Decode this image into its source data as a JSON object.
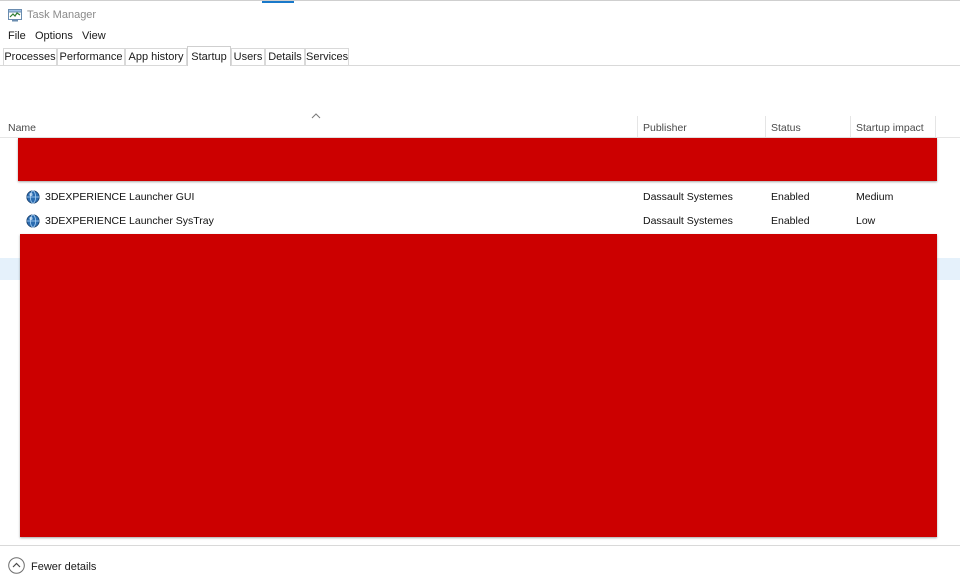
{
  "window": {
    "title": "Task Manager"
  },
  "menu": [
    "File",
    "Options",
    "View"
  ],
  "tabs": [
    "Processes",
    "Performance",
    "App history",
    "Startup",
    "Users",
    "Details",
    "Services"
  ],
  "active_tab": "Startup",
  "columns": {
    "name": "Name",
    "publisher": "Publisher",
    "status": "Status",
    "impact": "Startup impact"
  },
  "rows": [
    {
      "name": "3DEXPERIENCE Launcher GUI",
      "publisher": "Dassault Systemes",
      "status": "Enabled",
      "impact": "Medium"
    },
    {
      "name": "3DEXPERIENCE Launcher SysTray",
      "publisher": "Dassault Systemes",
      "status": "Enabled",
      "impact": "Low"
    }
  ],
  "footer": {
    "fewer_details": "Fewer details"
  },
  "colors": {
    "redaction": "#cc0000",
    "accent": "#1979ca",
    "selection": "#e5f1fb"
  },
  "icons": {
    "app": "task-manager-icon",
    "row": "globe-icon",
    "sort": "sort-ascending-icon",
    "footer": "chevron-up-circle-icon"
  }
}
